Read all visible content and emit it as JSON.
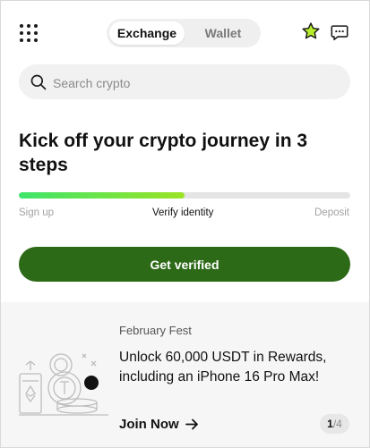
{
  "header": {
    "tabs": [
      {
        "label": "Exchange",
        "active": true
      },
      {
        "label": "Wallet",
        "active": false
      }
    ],
    "icons": {
      "menu": "grid-icon",
      "favorites": "star-icon",
      "messages": "chat-icon"
    }
  },
  "search": {
    "placeholder": "Search crypto"
  },
  "onboarding": {
    "headline": "Kick off your crypto journey in 3 steps",
    "progress": 0.5,
    "steps": [
      {
        "label": "Sign up",
        "state": "done"
      },
      {
        "label": "Verify identity",
        "state": "current"
      },
      {
        "label": "Deposit",
        "state": "todo"
      }
    ],
    "cta_label": "Get verified"
  },
  "promo": {
    "tag": "February Fest",
    "title": "Unlock 60,000 USDT in Rewards, including an iPhone 16 Pro Max!",
    "link_label": "Join Now",
    "page_current": "1",
    "page_separator": "/",
    "page_total": "4"
  },
  "colors": {
    "brand_green": "#2d6a17",
    "progress_start": "#3ee46b",
    "progress_end": "#9be324",
    "star_fill": "#b8ee2a"
  }
}
